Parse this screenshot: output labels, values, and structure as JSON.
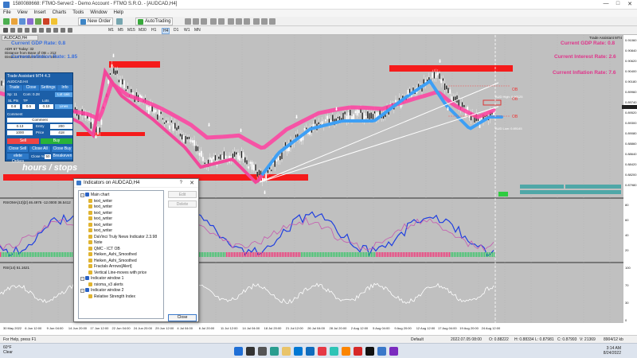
{
  "window": {
    "title": "1580088668: FTMO-Server2 - Demo Account - FTMO S.R.O. - [AUDCAD,H4]"
  },
  "menu": [
    "File",
    "View",
    "Insert",
    "Charts",
    "Tools",
    "Window",
    "Help"
  ],
  "toolbar": {
    "new_order": "New Order",
    "autotrading": "AutoTrading"
  },
  "timeframes": [
    "M1",
    "M5",
    "M15",
    "M30",
    "H1",
    "H4",
    "D1",
    "W1",
    "MN"
  ],
  "chart": {
    "tab": "AUDCAD,H4",
    "header_line1": "ADR 67   Today: 32",
    "header_line2": "Distance from Base of OB = 212",
    "header_line3": "Distance from Base of OB = 180",
    "gdp_left": "Current GDP Rate: 0.8",
    "inflation_left": "Current Inflation Rate: 1.85",
    "gdp_right": "Current GDP Rate: 0.8",
    "interest_right": "Current Interest Rate: 2.6",
    "inflation_right": "Current Inflation Rate: 7.6",
    "ta_label": "Trade Assistant MT4",
    "ob_label1": "OB",
    "ob_label2": "OB",
    "ob_label3": "OB",
    "ob_high_label": "AUD High: 0.90125",
    "ob_low_label": "AUD Low: 0.89145",
    "watermark": "hours / stops",
    "price_labels": [
      "0.91060",
      "0.90840",
      "0.90620",
      "0.90400",
      "0.90180",
      "0.89960",
      "0.89740",
      "0.89520",
      "0.89300",
      "0.89080",
      "0.88860",
      "0.88640",
      "0.88420",
      "0.88200",
      "0.87980"
    ],
    "date_labels": [
      "30 May 2022",
      "6 Jun 12:00",
      "9 Jun 04:00",
      "14 Jun 20:00",
      "17 Jun 12:00",
      "22 Jun 04:00",
      "24 Jun 20:00",
      "29 Jun 12:00",
      "4 Jul 04:00",
      "6 Jul 20:00",
      "11 Jul 12:00",
      "14 Jul 04:00",
      "18 Jul 20:00",
      "21 Jul 12:00",
      "26 Jul 04:00",
      "28 Jul 20:00",
      "2 Aug 12:00",
      "5 Aug 04:00",
      "9 Aug 20:00",
      "12 Aug 12:00",
      "17 Aug 04:00",
      "19 Aug 20:00",
      "24 Aug 12:00"
    ],
    "sub1_label": "RSIOMA(13)[2] 46.4975 -12.0000 36.5412",
    "sub1_levels": [
      "80",
      "60",
      "40",
      "20"
    ],
    "sub2_label": "RSI(14) 51.1621",
    "sub2_levels": [
      "100",
      "70",
      "30",
      "0"
    ]
  },
  "panel": {
    "title": "Trade Assistant MT4 4.3",
    "symbol": "AUDCAD.H4",
    "tabs": [
      "Trade",
      "Close",
      "Settings",
      "Info"
    ],
    "sp": "Sp: 11",
    "com": "Com: 0.28",
    "sl_lbl": "SL Pts",
    "tp_lbl": "TP",
    "lots_lbl": "Lots",
    "sl_val": "0.8",
    "tp_val": "0.5",
    "lots_val": "0.10",
    "comment_lbl": "Comment",
    "risk": "0.13",
    "entry_lbl": "Entry",
    "entry_val": "200",
    "pts": "1000",
    "price_lbl": "Price",
    "price_val": "418",
    "sell": "Sell",
    "buy": "Buy",
    "close_sell": "Close Sell",
    "close_all": "Close All",
    "close_buy": "Close Buy",
    "delete_orders": "elete Orders",
    "close_pct": "Close %",
    "close_pct_val": "50",
    "breakeven": "Breakeven"
  },
  "dialog": {
    "title": "Indicators on AUDCAD,H4",
    "help": "?",
    "edit": "Edit",
    "delete": "Delete",
    "close": "Close",
    "main_chart": "Main chart",
    "main_items": [
      "text_writer",
      "text_writer",
      "text_writer",
      "text_writer",
      "text_writer",
      "text_writer",
      "DaVinci Truly News Indicator 2.3.98",
      "Note",
      "QMC - ICT OB",
      "Heiken_Ashi_Smoothed",
      "Heiken_Ashi_Smoothed",
      "Fractals Arrows[Alert]",
      "Vertical Line-moves with price"
    ],
    "window1": "Indicator window 1",
    "window1_items": [
      "rsioma_v3 alerts"
    ],
    "window2": "Indicator window 2",
    "window2_items": [
      "Relative Strength Index"
    ]
  },
  "status": {
    "help": "For Help, press F1",
    "profile": "Default",
    "time": "2022.07.05 08:00",
    "open": "O: 0.88222",
    "high": "H: 0.88334",
    "low": "L: 0.87981",
    "close": "C: 0.87993",
    "volume": "V: 21369",
    "bars": "8904/12 kb"
  },
  "taskbar": {
    "temp": "60°F",
    "weather": "Clear",
    "time": "3:14 AM",
    "date": "8/24/2022"
  }
}
